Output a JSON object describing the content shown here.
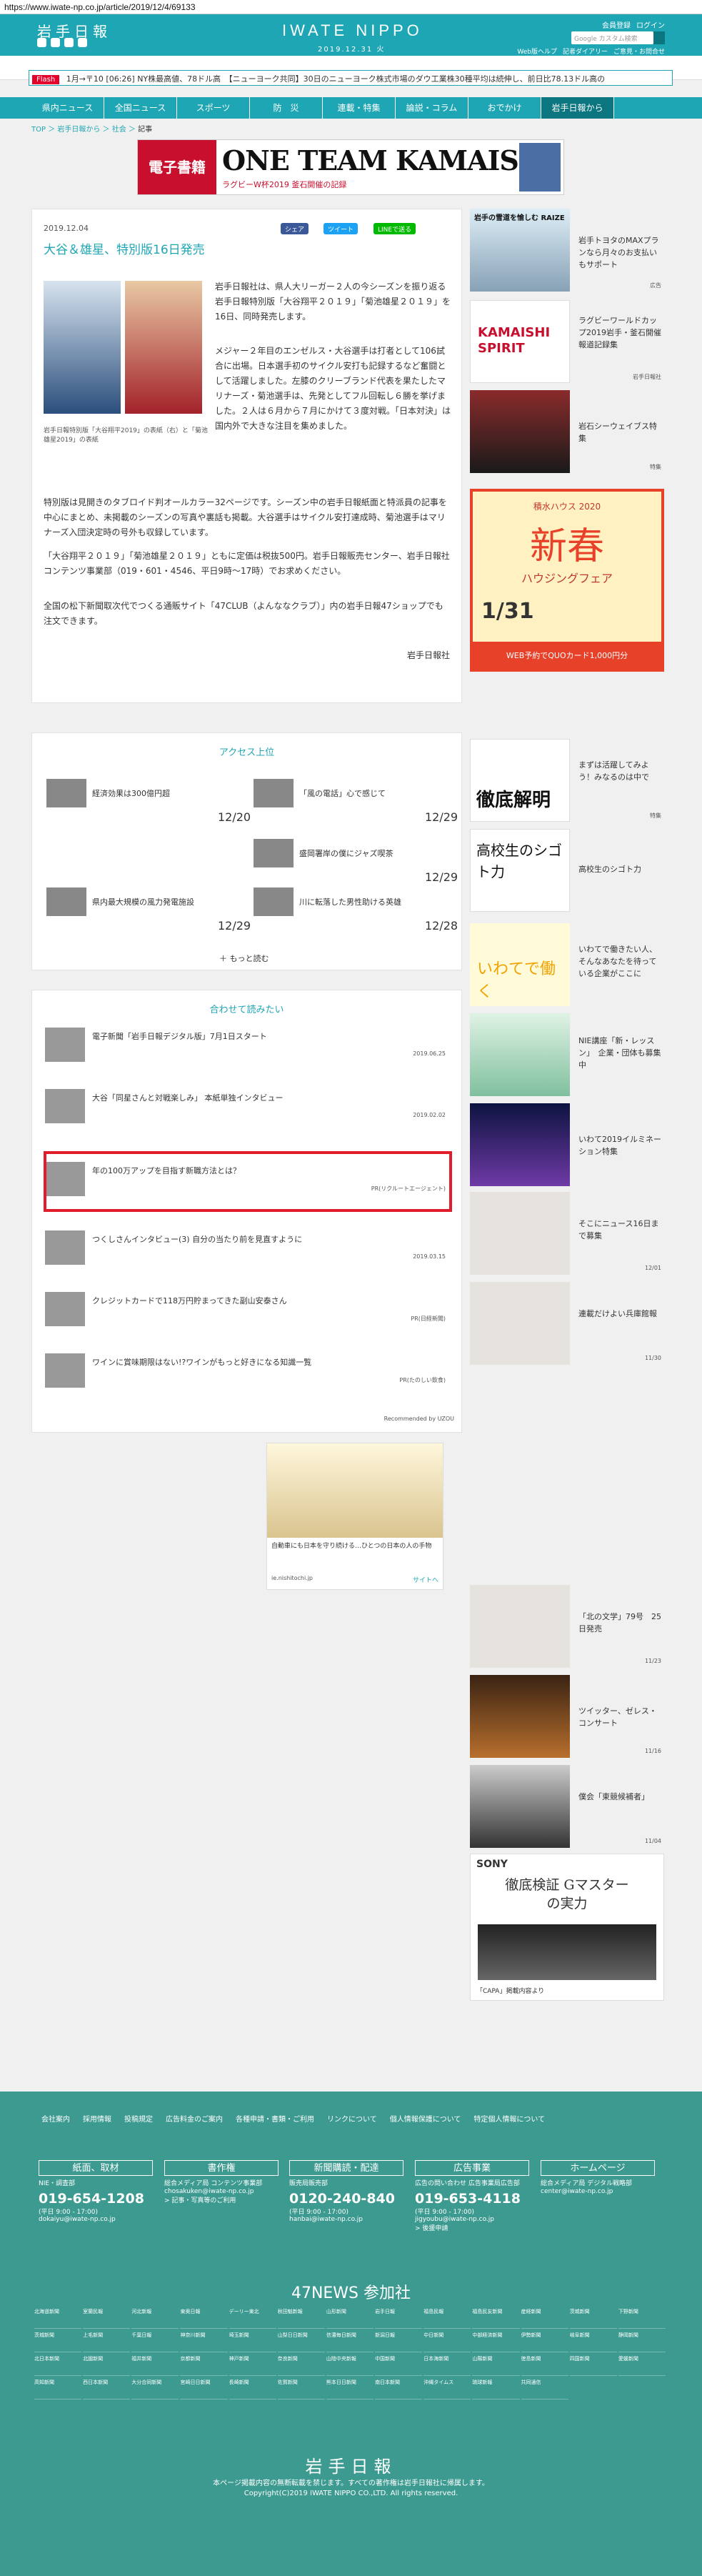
{
  "url": "https://www.iwate-np.co.jp/article/2019/12/4/69133",
  "header": {
    "logo": "岩手日報",
    "brand": "IWATE NIPPO",
    "date": "2019.12.31 火",
    "links": [
      "会員登録",
      "ログイン"
    ],
    "search_placeholder": "Google カスタム検索",
    "sub_links": [
      "Web版ヘルプ",
      "記者ダイアリー",
      "ご意見・お問合せ"
    ]
  },
  "ticker": {
    "flash": "Flash",
    "text": "1月→〒10  [06:26]  NY株最高値、78ドル高　【ニューヨーク共同】30日のニューヨーク株式市場のダウ工業株30種平均は続伸し、前日比78.13ドル高の"
  },
  "nav": [
    "県内ニュース",
    "全国ニュース",
    "スポーツ",
    "防　災",
    "連載・特集",
    "論説・コラム",
    "おでかけ",
    "岩手日報から"
  ],
  "breadcrumb": {
    "items": [
      "TOP",
      "岩手日報から",
      "社会"
    ],
    "current": "記事"
  },
  "banner": {
    "red": "電子書籍",
    "title": "ONE TEAM KAMAISHI",
    "sub": "ラグビーW杯2019 釜石開催の記録"
  },
  "article": {
    "date": "2019.12.04",
    "share": [
      "シェア",
      "ツイート",
      "LINEで送る"
    ],
    "title": "大谷＆雄星、特別版16日発売",
    "caption": "岩手日報特別版「大谷翔平2019」の表紙（右）と「菊池雄星2019」の表紙",
    "p1": "岩手日報社は、県人大リーガー２人の今シーズンを振り返る岩手日報特別版「大谷翔平２０１９」「菊池雄星２０１９」を16日、同時発売します。",
    "p2": "メジャー２年目のエンゼルス・大谷選手は打者として106試合に出場。日本選手初のサイクル安打も記録するなど奮闘として活躍しました。左膝のクリーブランド代表を果たしたマリナーズ・菊池選手は、先発としてフル回転し６勝を挙げました。２人は６月から７月にかけて３度対戦。「日本対決」は国内外で大きな注目を集めました。",
    "p3": "特別版は見開きのタブロイド判オールカラー32ページです。シーズン中の岩手日報紙面と特派員の記事を中心にまとめ、未掲載のシーズンの写真や裏話も掲載。大谷選手はサイクル安打達成時、菊池選手はマリナーズ入団決定時の号外も収録しています。",
    "p4": "「大谷翔平２０１９」「菊池雄星２０１９」ともに定価は税抜500円。岩手日報販売センター、岩手日報社コンテンツ事業部（019・601・4546、平日9時～17時）でお求めください。",
    "p5": "全国の松下新聞取次代でつくる通販サイト「47CLUB（よんななクラブ）」内の岩手日報47ショップでも注文できます。",
    "credit": "岩手日報社"
  },
  "access": {
    "title": "アクセス上位",
    "items": [
      {
        "title": "経済効果は300億円超",
        "date": "12/20"
      },
      {
        "title": "「風の電話」心で感じて",
        "date": "12/29"
      },
      {
        "title": "盛岡署岸の僕にジャズ喫茶",
        "date": "12/29"
      },
      {
        "title": "県内最大規模の風力発電施設",
        "date": "12/29"
      },
      {
        "title": "川に転落した男性助ける英雄",
        "date": "12/28"
      }
    ],
    "more": "もっと読む"
  },
  "related": {
    "title": "合わせて読みたい",
    "items": [
      {
        "title": "電子新聞「岩手日報デジタル版」7月1日スタート",
        "date": "2019.06.25"
      },
      {
        "title": "大谷「同星さんと対戦楽しみ」 本紙単独インタビュー",
        "date": "2019.02.02"
      },
      {
        "title": "年の100万アップを目指す新職方法とは？",
        "date": "PR(リクルートエージェント)"
      },
      {
        "title": "つくしさんインタビュー(3) 自分の当たり前を見直すように",
        "date": "2019.03.15"
      },
      {
        "title": "クレジットカードで118万円貯まってきた副山安泰さん",
        "date": "PR(日経新聞)"
      },
      {
        "title": "ワインに賞味期限はない!?ワインがもっと好きになる知識一覧",
        "date": "PR(たのしい飲食)"
      }
    ],
    "recommend": "Recommended by UZOU"
  },
  "ad2": {
    "text": "自動車にも日本を守り続ける…ひとつの日本の人の手物",
    "domain": "ie.nishitochi.jp",
    "link": "サイトへ"
  },
  "sidebar": [
    {
      "text": "岩手トヨタのMAXプランなら月々のお支払いもサポート",
      "date": "広告"
    },
    {
      "text": "ラグビーワールドカップ2019岩手・釜石開催報道記録集",
      "date": "岩手日報社"
    },
    {
      "text": "岩石シーウェイブス特集",
      "date": "特集"
    },
    {
      "text": "まずは活躍してみよう！みなるのは中で",
      "date": "特集"
    },
    {
      "text": "高校生のシゴト力",
      "date": ""
    },
    {
      "text": "いわてで働きたい人、そんなあなたを待っている企業がここに",
      "date": ""
    },
    {
      "text": "NIE講座「新・レッスン」　企業・団体も募集中",
      "date": ""
    },
    {
      "text": "いわて2019イルミネーション特集",
      "date": ""
    },
    {
      "text": "そこにニュース16日まで募集",
      "date": "12/01"
    },
    {
      "text": "連載だけよい兵庫館報",
      "date": "11/30"
    },
    {
      "text": "「北の文学」79号　25日発売",
      "date": "11/23"
    },
    {
      "text": "ツイッター、ゼレス・コンサート",
      "date": "11/16"
    },
    {
      "text": "僕会「東競候補者」",
      "date": "11/04"
    }
  ],
  "sidebar_ads": {
    "raize": "岩手の雪道を愉しむ RAIZE",
    "kamaishi": "KAMAISHI SPIRIT",
    "shinshun_brand": "積水ハウス 2020",
    "shinshun": "新春",
    "shinshun_sub": "ハウジングフェア",
    "shinshun_date": "1/31",
    "shinshun_note": "WEB予約でQUOカード1,000円分",
    "tettei": "徹底解明",
    "koukou": "高校生のシゴト力",
    "hataraku": "いわてで働く",
    "sony_brand": "SONY",
    "sony_title": "徹底検証 Gマスターの実力",
    "sony_src": "「CAPA」掲載内容より"
  },
  "footer": {
    "links": [
      "会社案内",
      "採用情報",
      "投稿規定",
      "広告料金のご案内",
      "各種申請・書類・ご利用",
      "リンクについて",
      "個人情報保護について",
      "特定個人情報について"
    ],
    "cols": [
      {
        "head": "紙面、取材",
        "sub": "NIE・調査部",
        "tel": "019-654-1208",
        "hours": "(平日 9:00 - 17:00)",
        "mail": "dokaiyu@iwate-np.co.jp"
      },
      {
        "head": "書作権",
        "sub": "総合メディア局 コンテンツ事業部",
        "tel": "",
        "hours": "",
        "mail": "chosakuken@iwate-np.co.jp",
        "note": "> 記事・写真等のご利用"
      },
      {
        "head": "新聞購読・配達",
        "sub": "販売局販売部",
        "tel": "0120-240-840",
        "hours": "(平日 9:00 - 17:00)",
        "mail": "hanbai@iwate-np.co.jp"
      },
      {
        "head": "広告事業",
        "sub": "広告の問い合わせ 広告事業局広告部",
        "tel": "019-653-4118",
        "hours": "(平日 9:00 - 17:00)",
        "mail": "jigyoubu@iwate-np.co.jp",
        "note": "> 後援申請"
      },
      {
        "head": "ホームページ",
        "sub": "総合メディア局 デジタル戦略部",
        "tel": "",
        "hours": "",
        "mail": "center@iwate-np.co.jp"
      }
    ],
    "n47": "47NEWS 参加社",
    "papers": [
      "北海道新聞",
      "室蘭民報",
      "河北新報",
      "東奥日報",
      "デーリー東北",
      "秋田魁新報",
      "山形新聞",
      "岩手日報",
      "福島民報",
      "福島民友新聞",
      "産経新聞",
      "茨城新聞",
      "下野新聞",
      "茨城新聞",
      "上毛新聞",
      "千葉日報",
      "神奈川新聞",
      "埼玉新聞",
      "山梨日日新聞",
      "信濃毎日新聞",
      "新潟日報",
      "中日新聞",
      "中部経済新聞",
      "伊勢新聞",
      "岐阜新聞",
      "静岡新聞",
      "北日本新聞",
      "北國新聞",
      "福井新聞",
      "京都新聞",
      "神戸新聞",
      "奈良新聞",
      "山陰中央新報",
      "中国新聞",
      "日本海新聞",
      "山陽新聞",
      "徳島新聞",
      "四国新聞",
      "愛媛新聞",
      "高知新聞",
      "西日本新聞",
      "大分合同新聞",
      "宮崎日日新聞",
      "長崎新聞",
      "佐賀新聞",
      "熊本日日新聞",
      "南日本新聞",
      "沖縄タイムス",
      "琉球新報",
      "共同通信"
    ],
    "logo": "岩手日報",
    "copy1": "本ページ掲載内容の無断転載を禁じます。すべての著作権は岩手日報社に帰属します。",
    "copy2": "Copyright(C)2019 IWATE NIPPO CO.,LTD. All rights reserved."
  },
  "colors": {
    "accent": "#1fa6b4",
    "dark_accent": "#0b7580",
    "footer": "#3d9a90",
    "highlight": "#e11d2b"
  }
}
